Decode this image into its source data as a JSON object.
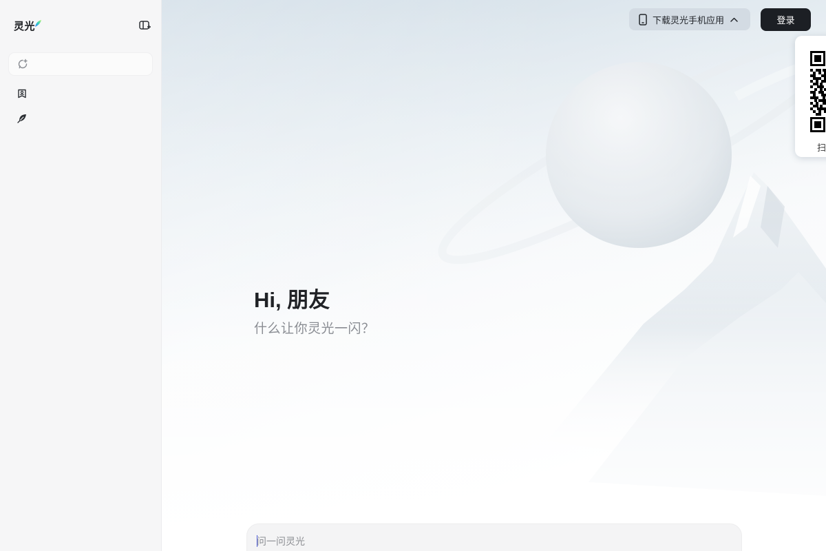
{
  "app": {
    "logo_text": "灵光"
  },
  "sidebar": {
    "collapse_icon": "sidebar-toggle-icon",
    "new_chat": {
      "icon": "new-chat-icon",
      "label": ""
    },
    "items": [
      {
        "icon": "bookmark-person-icon",
        "label": ""
      },
      {
        "icon": "feather-leaf-icon",
        "label": ""
      }
    ]
  },
  "header": {
    "download_label": "下载灵光手机应用",
    "login_label": "登录"
  },
  "qr_panel": {
    "caption": "扫"
  },
  "main": {
    "greeting": "Hi, 朋友",
    "subtitle": "什么让你灵光一闪？"
  },
  "input": {
    "placeholder": "问一问灵光",
    "value": ""
  },
  "colors": {
    "sidebar_bg": "#f6f6f7",
    "login_bg": "#1c1f24",
    "download_bg": "#d3dbe3",
    "accent_caret": "#4d5bd9"
  }
}
